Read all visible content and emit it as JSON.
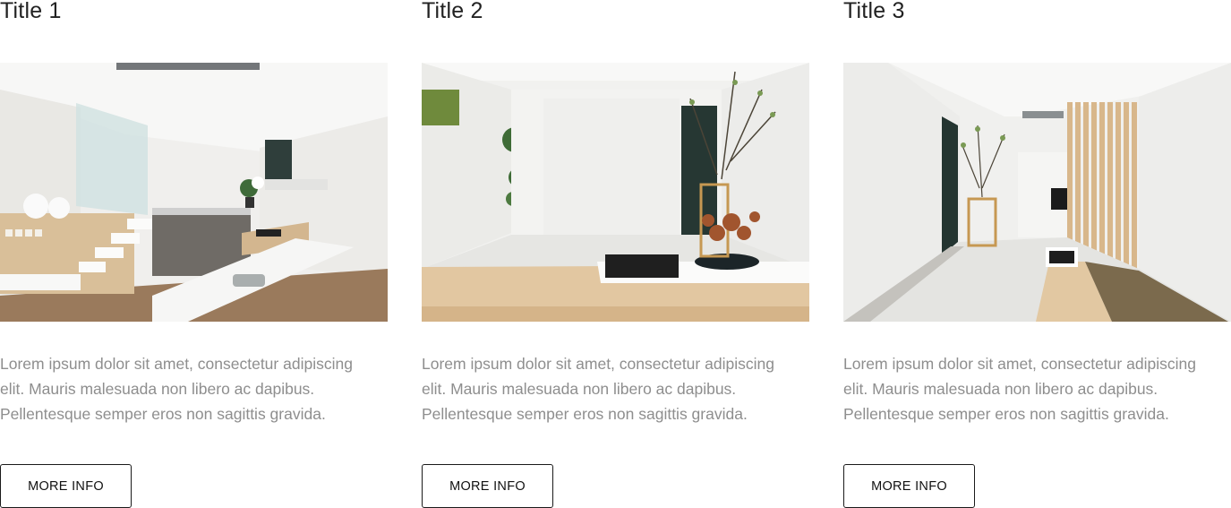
{
  "cards": [
    {
      "title": "Title 1",
      "image_subject": "modern white kitchen interior with floating stairs",
      "text": "Lorem ipsum dolor sit amet, consectetur adipiscing elit. Mauris malesuada non libero ac dapibus. Pellentesque semper eros non sagittis gravida.",
      "button_label": "MORE INFO"
    },
    {
      "title": "Title 2",
      "image_subject": "minimal white room with bonsai tree and wall plants",
      "text": "Lorem ipsum dolor sit amet, consectetur adipiscing elit. Mauris malesuada non libero ac dapibus. Pellentesque semper eros non sagittis gravida.",
      "button_label": "MORE INFO"
    },
    {
      "title": "Title 3",
      "image_subject": "white hallway with wooden slat partition",
      "text": "Lorem ipsum dolor sit amet, consectetur adipiscing elit. Mauris malesuada non libero ac dapibus. Pellentesque semper eros non sagittis gravida.",
      "button_label": "MORE INFO"
    }
  ]
}
